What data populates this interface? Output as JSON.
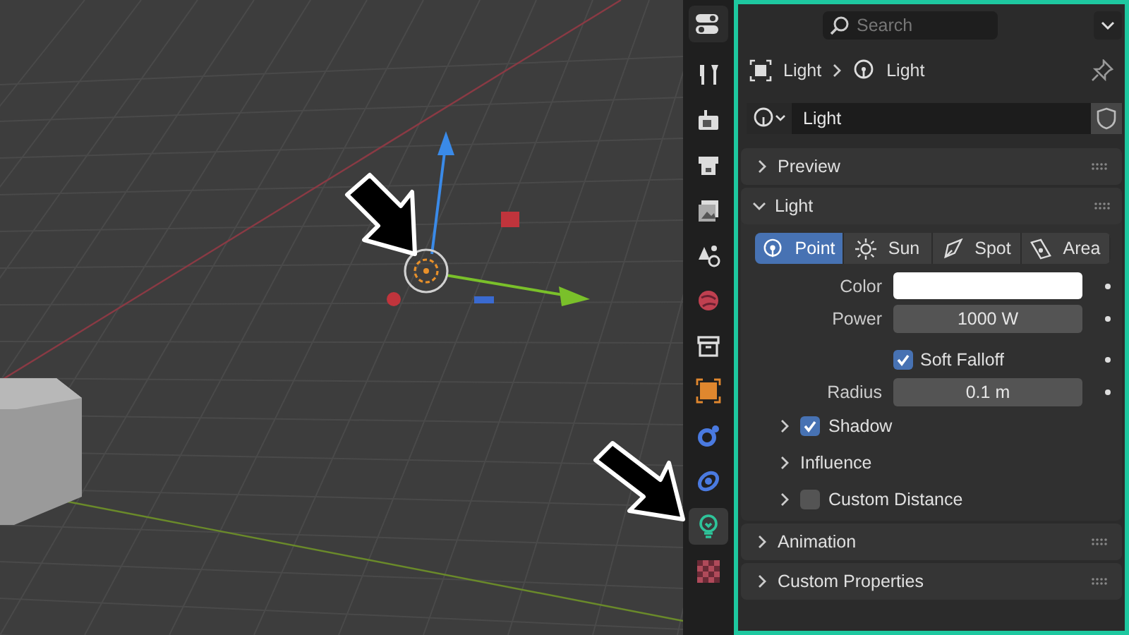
{
  "tabs": [
    {
      "kind": "tool",
      "selected": false
    },
    {
      "kind": "render",
      "selected": false
    },
    {
      "kind": "output",
      "selected": false
    },
    {
      "kind": "view-layer",
      "selected": false
    },
    {
      "kind": "scene",
      "selected": false
    },
    {
      "kind": "world",
      "selected": false
    },
    {
      "kind": "collection",
      "selected": false
    },
    {
      "kind": "object",
      "selected": false
    },
    {
      "kind": "physics",
      "selected": false
    },
    {
      "kind": "constraints",
      "selected": false
    },
    {
      "kind": "light",
      "selected": true
    },
    {
      "kind": "texture",
      "selected": false
    }
  ],
  "search": {
    "placeholder": "Search"
  },
  "breadcrumb": [
    "Light",
    "Light"
  ],
  "datablock": {
    "value": "Light"
  },
  "top_panels": [
    {
      "title": "Preview",
      "expanded": false
    }
  ],
  "light_panel": {
    "title": "Light",
    "expanded": true,
    "types": [
      {
        "label": "Point",
        "selected": true
      },
      {
        "label": "Sun",
        "selected": false
      },
      {
        "label": "Spot",
        "selected": false
      },
      {
        "label": "Area",
        "selected": false
      }
    ],
    "rows": [
      {
        "kind": "color",
        "label": "Color"
      },
      {
        "kind": "number",
        "label": "Power",
        "value": "1000 W"
      },
      {
        "kind": "checkbox",
        "label": "Soft Falloff",
        "checked": true
      },
      {
        "kind": "number",
        "label": "Radius",
        "value": "0.1 m"
      }
    ],
    "subpanels": [
      {
        "kind": "checkbox",
        "title": "Shadow",
        "checked": true,
        "expanded": false
      },
      {
        "kind": "plain",
        "title": "Influence",
        "expanded": false
      },
      {
        "kind": "checkbox",
        "title": "Custom Distance",
        "checked": false,
        "expanded": false
      }
    ]
  },
  "bottom_panels": [
    {
      "title": "Animation",
      "expanded": false
    },
    {
      "title": "Custom Properties",
      "expanded": false
    }
  ]
}
